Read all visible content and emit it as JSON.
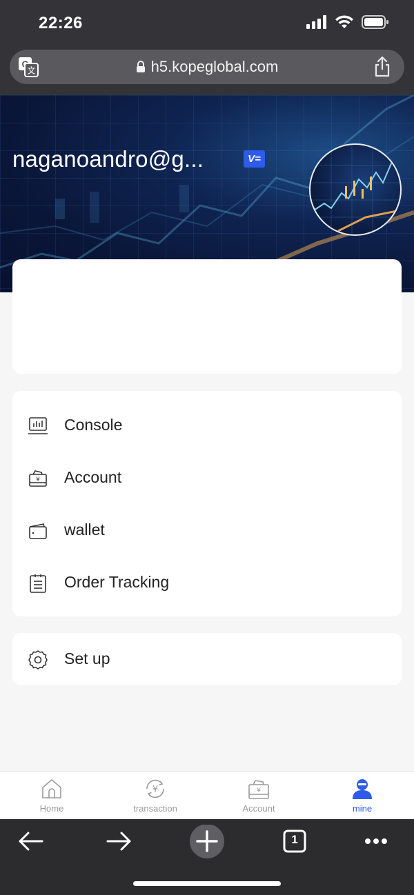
{
  "status_bar": {
    "time": "22:26"
  },
  "browser": {
    "url": "h5.kopeglobal.com",
    "tab_count": "1"
  },
  "profile": {
    "email": "naganoandro@g...",
    "vip_badge": "V="
  },
  "menu": {
    "items": [
      {
        "label": "Console",
        "icon": "console-icon"
      },
      {
        "label": "Account",
        "icon": "account-wallet-icon"
      },
      {
        "label": "wallet",
        "icon": "wallet-icon"
      },
      {
        "label": "Order Tracking",
        "icon": "clipboard-icon"
      }
    ],
    "setup": {
      "label": "Set up",
      "icon": "gear-icon"
    }
  },
  "tabbar": {
    "tabs": [
      {
        "label": "Home",
        "icon": "home-icon"
      },
      {
        "label": "transaction",
        "icon": "yen-exchange-icon"
      },
      {
        "label": "Account",
        "icon": "account-icon"
      },
      {
        "label": "mine",
        "icon": "user-icon",
        "active": true
      }
    ]
  },
  "colors": {
    "accent": "#2f5bea",
    "status_bar_bg": "#343438",
    "page_bg": "#f6f6f7"
  }
}
